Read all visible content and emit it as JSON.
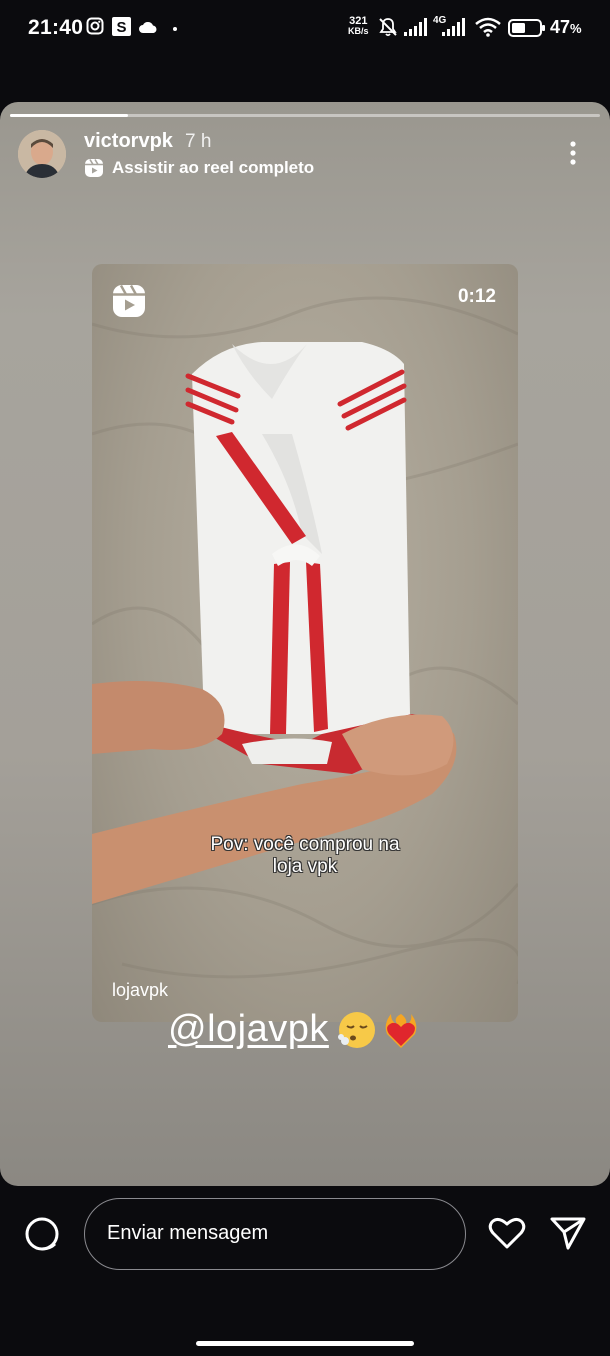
{
  "status_bar": {
    "time": "21:40",
    "net_speed_value": "321",
    "net_speed_unit": "KB/s",
    "network_type": "4G",
    "battery_percent": "47",
    "battery_unit": "%"
  },
  "story": {
    "progress_fraction": 0.2,
    "username": "victorvpk",
    "time_ago": "7 h",
    "reel_link_label": "Assistir ao reel completo",
    "reel": {
      "duration": "0:12",
      "caption_line1": "Pov: você comprou na",
      "caption_line2": "loja vpk",
      "handle": "lojavpk"
    },
    "mention": "@lojavpk"
  },
  "bottom_bar": {
    "message_placeholder": "Enviar mensagem"
  },
  "icons": [
    "camera-icon",
    "heart-icon",
    "send-icon",
    "more-options-icon",
    "reels-icon"
  ],
  "colors": {
    "background": "#0b0b0e",
    "story_bg": "#a7a49d",
    "shirt_red": "#d0282f"
  }
}
